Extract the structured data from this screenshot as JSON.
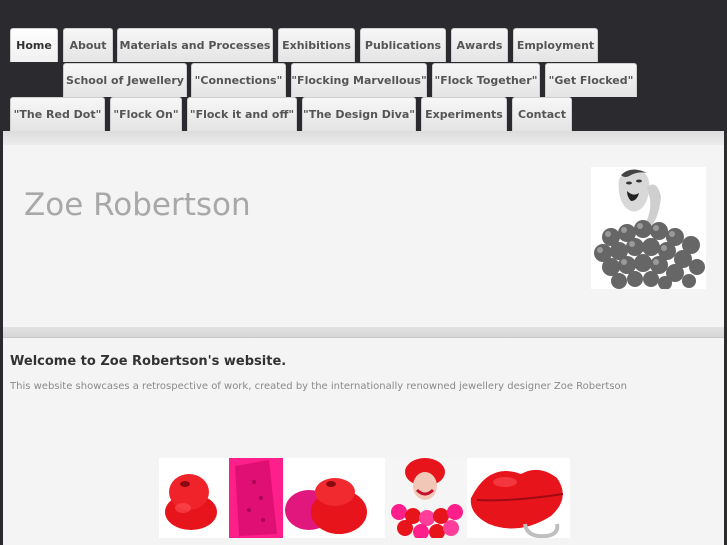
{
  "nav": {
    "row1": [
      "Home",
      "About",
      "Materials and Processes",
      "Exhibitions",
      "Publications",
      "Awards",
      "Employment"
    ],
    "row2": [
      "School of Jewellery",
      "\"Connections\"",
      "\"Flocking Marvellous\"",
      "\"Flock Together\"",
      "\"Get Flocked\""
    ],
    "row3": [
      "\"The Red Dot\"",
      "\"Flock On\"",
      "\"Flock it and off\"",
      "\"The Design Diva\"",
      "Experiments",
      "Contact"
    ]
  },
  "header": {
    "site_title": "Zoe Robertson"
  },
  "main": {
    "welcome": "Welcome to Zoe Robertson's website.",
    "intro": "This website showcases a retrospective of work, created by the internationally renowned jewellery designer Zoe Robertson"
  },
  "colors": {
    "background": "#2b2b2f",
    "tab": "#eeeeee",
    "flock_red": "#e8141c",
    "flock_pink": "#ff1f8a"
  }
}
